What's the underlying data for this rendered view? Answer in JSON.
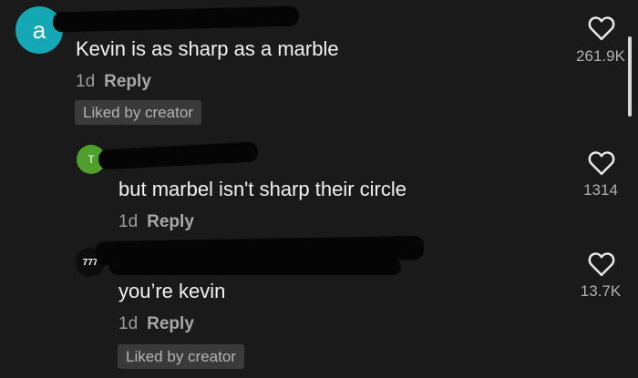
{
  "comments": [
    {
      "avatar_letter": "a",
      "text": "Kevin is as sharp as a marble",
      "time": "1d",
      "reply_label": "Reply",
      "badge": "Liked by creator",
      "likes": "261.9K",
      "icon": "heart-outline-icon"
    },
    {
      "avatar_letter": "T",
      "text": "but marbel isn't sharp their circle",
      "time": "1d",
      "reply_label": "Reply",
      "likes": "1314",
      "icon": "heart-outline-icon"
    },
    {
      "avatar_letter": "777",
      "text": "you’re kevin",
      "time": "1d",
      "reply_label": "Reply",
      "badge": "Liked by creator",
      "likes": "13.7K",
      "icon": "heart-outline-icon"
    }
  ],
  "colors": {
    "background": "#1a1a1a",
    "avatar_1": "#14a7b4",
    "avatar_2": "#4f9f2c",
    "badge_bg": "#3a3a3a"
  }
}
